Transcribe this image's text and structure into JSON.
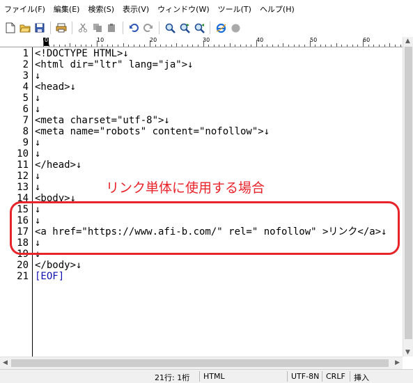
{
  "menu": [
    "ファイル(F)",
    "編集(E)",
    "検索(S)",
    "表示(V)",
    "ウィンドウ(W)",
    "ツール(T)",
    "ヘルプ(H)"
  ],
  "toolbar_icons": [
    "new-file-icon",
    "open-folder-icon",
    "save-icon",
    "print-icon",
    "cut-icon",
    "copy-icon",
    "paste-icon",
    "undo-icon",
    "redo-icon",
    "search-icon",
    "search-next-icon",
    "search-prev-icon",
    "browser-icon",
    "record-icon"
  ],
  "ruler": {
    "marks": [
      "0",
      "10",
      "20",
      "30",
      "40",
      "50",
      "60"
    ]
  },
  "editor": {
    "line_numbers": [
      "1",
      "2",
      "3",
      "4",
      "5",
      "6",
      "7",
      "8",
      "9",
      "10",
      "11",
      "12",
      "13",
      "14",
      "15",
      "16",
      "17",
      "18",
      "19",
      "20",
      "21"
    ],
    "lines": [
      "<!DOCTYPE HTML>↓",
      "<html dir=\"ltr\" lang=\"ja\">↓",
      "↓",
      "<head>↓",
      "↓",
      "↓",
      "<meta charset=\"utf-8\">↓",
      "<meta name=\"robots\" content=\"nofollow\">↓",
      "↓",
      "↓",
      "</head>↓",
      "↓",
      "↓",
      "<body>↓",
      "↓",
      "↓",
      "<a href=\"https://www.afi-b.com/\" rel=\" nofollow\" >リンク</a>↓",
      "↓",
      "↓",
      "</body>↓",
      "[EOF]"
    ]
  },
  "annotation": {
    "label": "リンク単体に使用する場合",
    "color": "#e8242b"
  },
  "status": {
    "position": "21行: 1桁",
    "mode": "HTML",
    "encoding": "UTF-8N",
    "line_ending": "CRLF",
    "insert_mode": "挿入"
  }
}
